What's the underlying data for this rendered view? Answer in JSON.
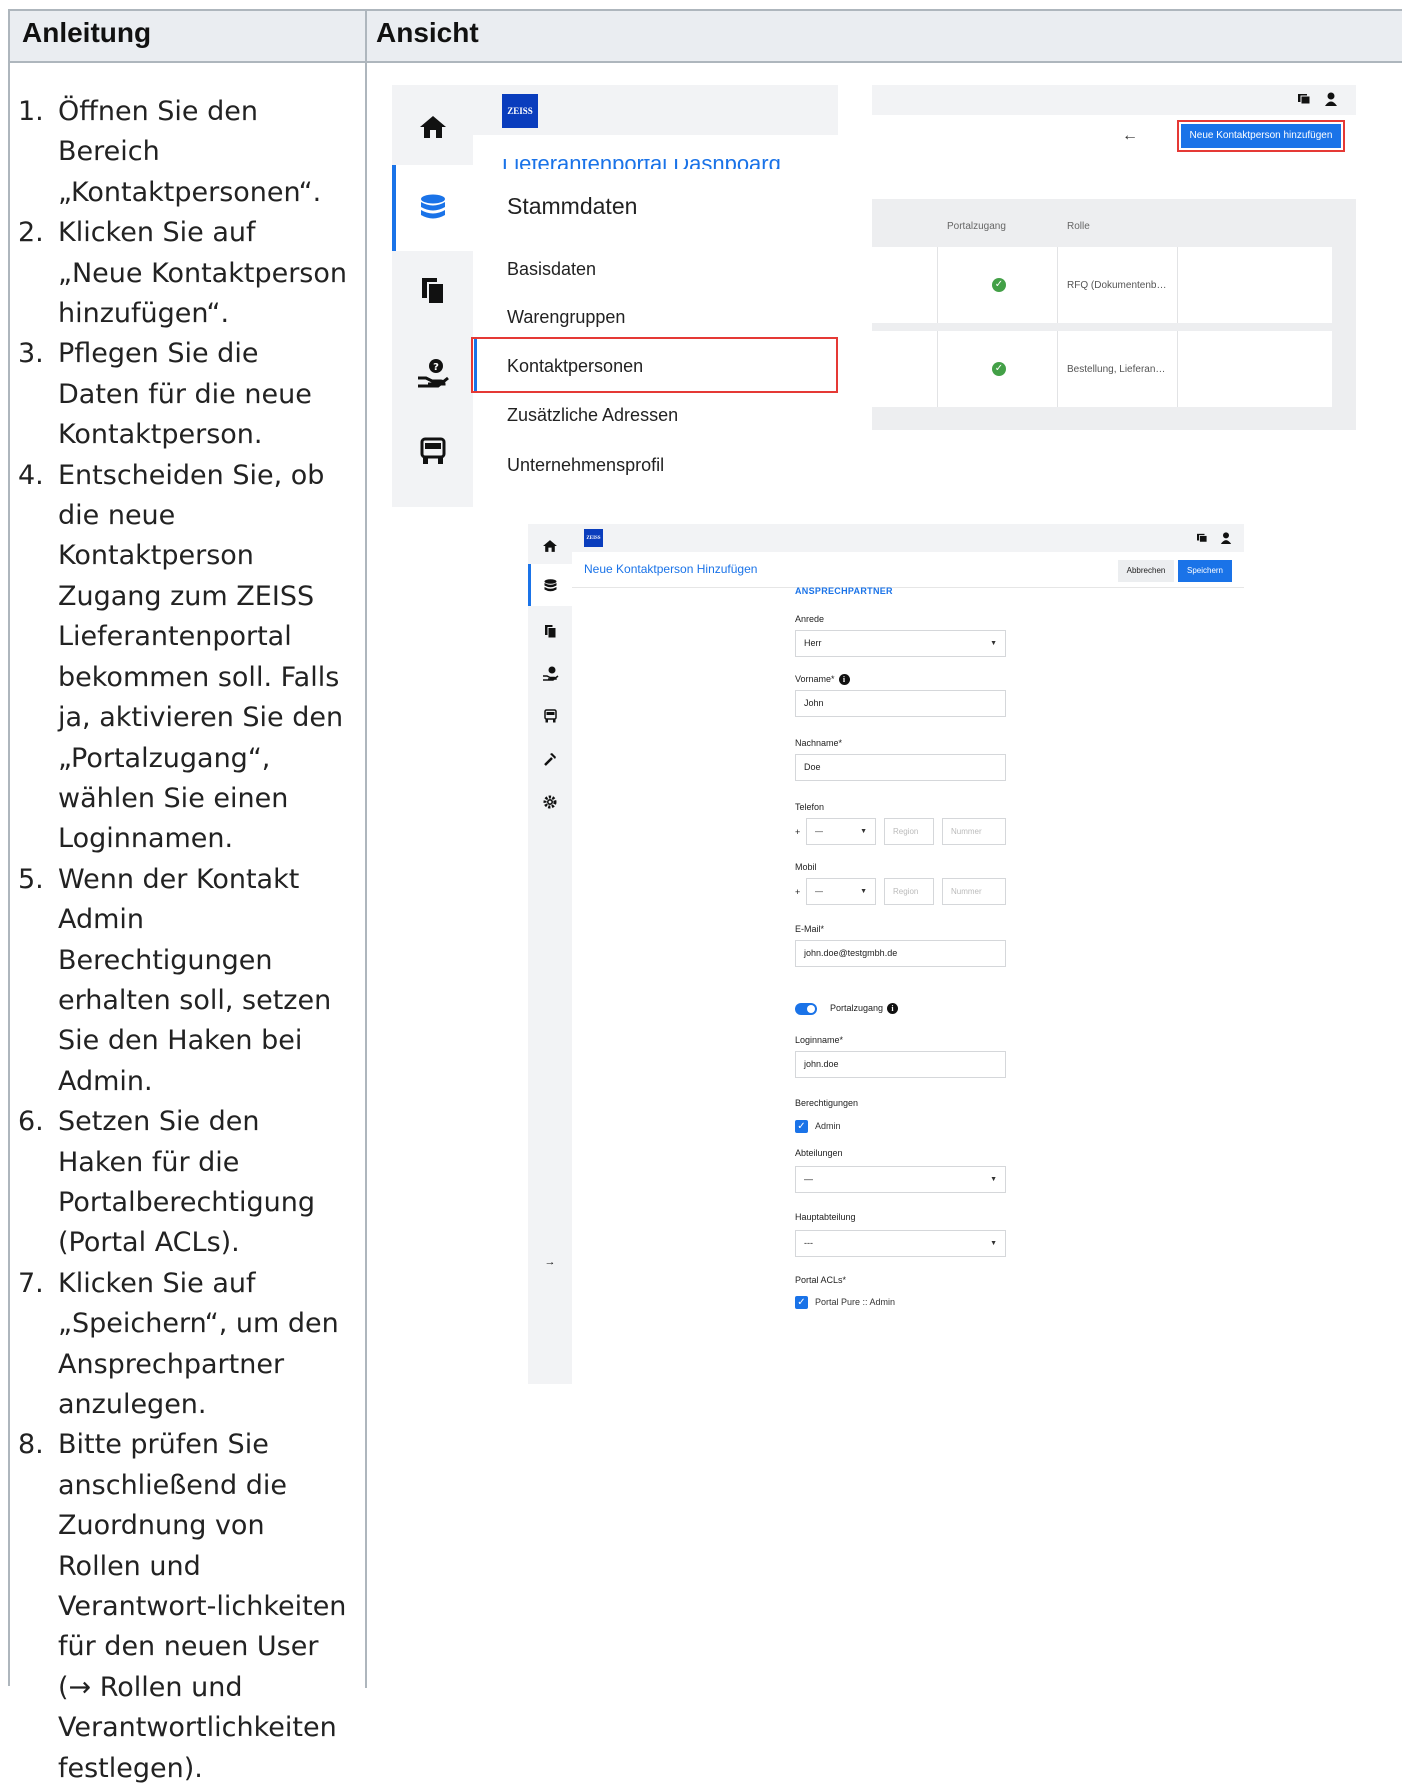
{
  "table": {
    "col1_header": "Anleitung",
    "col2_header": "Ansicht"
  },
  "instructions": [
    {
      "num": "1.",
      "text": "Öffnen Sie den Bereich „Kontaktpersonen“."
    },
    {
      "num": "2.",
      "text": "Klicken Sie auf „Neue Kontaktperson hinzufügen“."
    },
    {
      "num": "3.",
      "text": "Pflegen Sie die Daten für die neue Kontaktperson."
    },
    {
      "num": "4.",
      "text": "Entscheiden Sie, ob die neue Kontaktperson Zugang zum ZEISS Lieferantenportal bekommen soll. Falls ja, aktivieren Sie den „Portalzugang“, wählen Sie einen Loginnamen."
    },
    {
      "num": "5.",
      "text": "Wenn der Kontakt Admin Berechtigungen erhalten soll, setzen Sie den Haken bei Admin."
    },
    {
      "num": "6.",
      "text": "Setzen Sie den Haken für die Portalberechtigung (Portal ACLs)."
    },
    {
      "num": "7.",
      "text": " Klicken Sie auf „Speichern“, um den Ansprechpartner anzulegen."
    },
    {
      "num": "8.",
      "text": "Bitte prüfen Sie anschließend die Zuordnung von Rollen und Verantwort-lichkeiten für den neuen User (→ Rollen und Verantwortlichkeiten festlegen)."
    }
  ],
  "sidebar_shot": {
    "logo": "ZEISS",
    "clipped_text": "Lieferantenportal Dashboard",
    "menu_title": "Stammdaten",
    "items": [
      "Basisdaten",
      "Warengruppen",
      "Kontaktpersonen",
      "Zusätzliche Adressen",
      "Unternehmensprofil"
    ],
    "icons": [
      "home-icon",
      "database-icon",
      "documents-icon",
      "support-icon",
      "truck-icon"
    ]
  },
  "table_shot": {
    "back_arrow": "←",
    "new_button": "Neue Kontaktperson hinzufügen",
    "headers": [
      "Portalzugang",
      "Rolle"
    ],
    "rows": [
      {
        "access": "✓",
        "role": "RFQ (Dokumentenb…"
      },
      {
        "access": "✓",
        "role": "Bestellung, Lieferan…"
      }
    ]
  },
  "form_shot": {
    "logo": "ZEISS",
    "title": "Neue Kontaktperson Hinzufügen",
    "cancel": "Abbrechen",
    "save": "Speichern",
    "section": "ANSPRECHPARTNER",
    "anrede_label": "Anrede",
    "anrede_value": "Herr",
    "vorname_label": "Vorname*",
    "vorname_value": "John",
    "nachname_label": "Nachname*",
    "nachname_value": "Doe",
    "telefon_label": "Telefon",
    "mobil_label": "Mobil",
    "plus": "+",
    "dash": "—",
    "region": "Region",
    "nummer": "Nummer",
    "email_label": "E-Mail*",
    "email_value": "john.doe@testgmbh.de",
    "portal_label": "Portalzugang",
    "login_label": "Loginname*",
    "login_value": "john.doe",
    "perm_label": "Berechtigungen",
    "perm_value": "Admin",
    "dept_label": "Abteilungen",
    "dept_value": "—",
    "main_dept_label": "Hauptabteilung",
    "main_dept_value": "---",
    "acl_label": "Portal ACLs*",
    "acl_value": "Portal Pure :: Admin",
    "collapse_arrow": "→"
  }
}
